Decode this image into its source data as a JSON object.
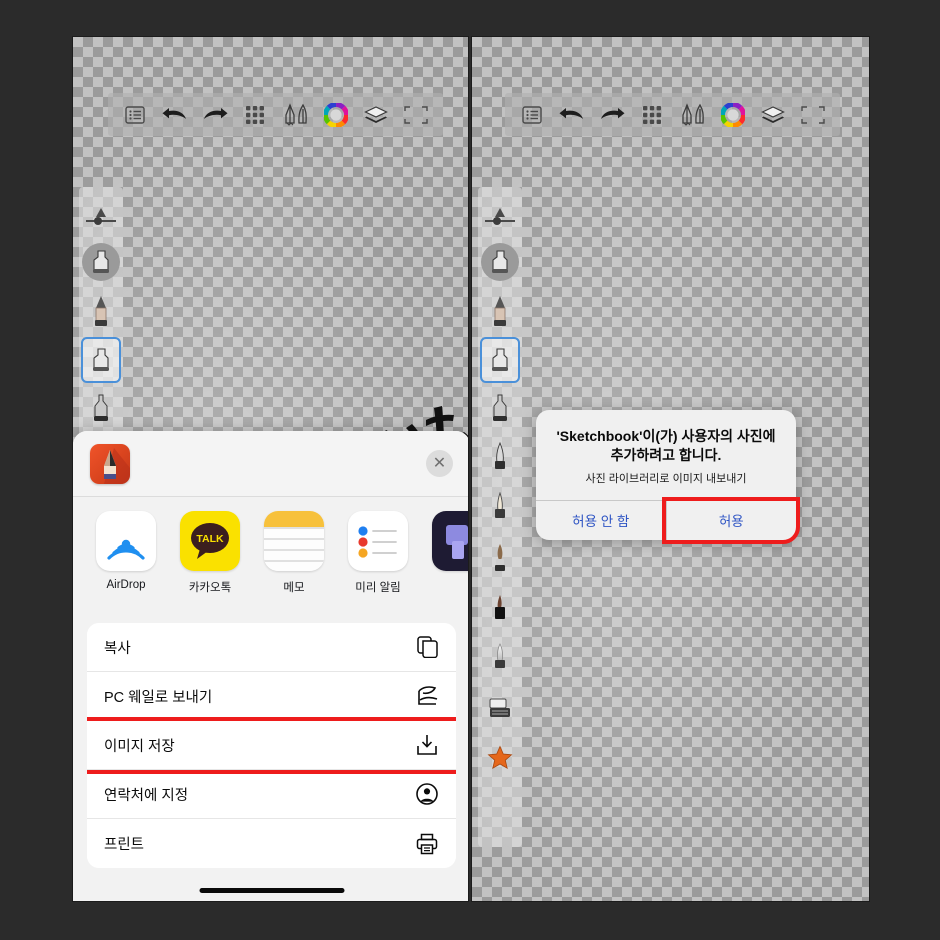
{
  "app": {
    "name": "Sketchbook",
    "background_color": "#2b2b2b",
    "highlight_color": "#ee1c1c",
    "accent_blue": "#2f55c4"
  },
  "toolbar": {
    "items": [
      {
        "name": "menu-icon",
        "label": "메뉴"
      },
      {
        "name": "undo-icon",
        "label": "실행 취소"
      },
      {
        "name": "redo-icon",
        "label": "다시 실행"
      },
      {
        "name": "grid-icon",
        "label": "격자"
      },
      {
        "name": "brushes-icon",
        "label": "브러시"
      },
      {
        "name": "color-wheel-icon",
        "label": "색상"
      },
      {
        "name": "layers-icon",
        "label": "레이어"
      },
      {
        "name": "fullscreen-icon",
        "label": "전체 화면"
      }
    ]
  },
  "brush_rail": {
    "slider_label": "브러시 크기",
    "left_panel_brushes": [
      "현재 브러시",
      "연필",
      "마커",
      "에어브러시"
    ],
    "right_panel_brushes": [
      "현재 브러시",
      "연필",
      "마커",
      "에어브러시",
      "잉크펜",
      "만년필",
      "붓",
      "립스틱",
      "그라데이션",
      "지우개",
      "즐겨찾기"
    ],
    "selected_index": 2
  },
  "share_sheet": {
    "app_icon_name": "sketchbook-app-icon",
    "close_label": "✕",
    "apps": [
      {
        "id": "airdrop",
        "label": "AirDrop"
      },
      {
        "id": "kakao",
        "label": "카카오톡"
      },
      {
        "id": "memo",
        "label": "메모"
      },
      {
        "id": "remind",
        "label": "미리 알림"
      },
      {
        "id": "cut",
        "label": ""
      }
    ],
    "actions": [
      {
        "label": "복사",
        "icon": "copy-icon",
        "highlight": false
      },
      {
        "label": "PC 웨일로 보내기",
        "icon": "whale-icon",
        "highlight": false
      },
      {
        "label": "이미지 저장",
        "icon": "save-image-icon",
        "highlight": true
      },
      {
        "label": "연락처에 지정",
        "icon": "contact-icon",
        "highlight": false
      },
      {
        "label": "프린트",
        "icon": "print-icon",
        "highlight": false
      }
    ]
  },
  "alert": {
    "title": "'Sketchbook'이(가) 사용자의 사진에 추가하려고 합니다.",
    "message": "사진 라이브러리로 이미지 내보내기",
    "deny_label": "허용 안 함",
    "allow_label": "허용",
    "highlighted_button": "허용"
  }
}
